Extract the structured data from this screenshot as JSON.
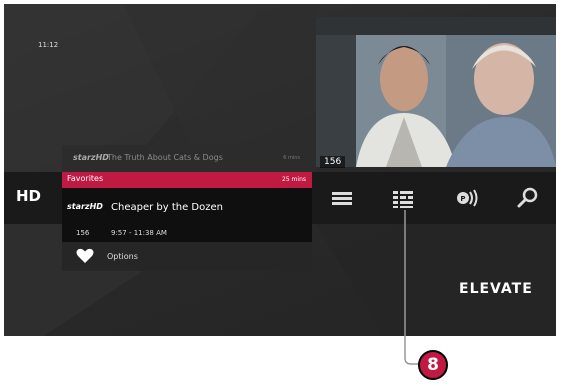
{
  "status": {
    "clock": "11:12"
  },
  "video": {
    "channel": "156"
  },
  "previous_program": {
    "network_logo": "starzHD",
    "title": "The Truth About Cats & Dogs",
    "remaining": "6 mins"
  },
  "navbar": {
    "hd_label": "HD",
    "icons": [
      "menu-icon",
      "guide-icon",
      "on-demand-icon",
      "search-icon"
    ]
  },
  "current_program": {
    "group_label": "Favorites",
    "remaining": "25 mins",
    "network_logo": "starzHD",
    "title": "Cheaper by the Dozen",
    "channel": "156",
    "time_range": "9:57 - 11:38 AM"
  },
  "options": {
    "label": "Options"
  },
  "brand": {
    "name": "ELEVATE"
  },
  "callout": {
    "number": "8"
  },
  "colors": {
    "accent": "#c11a42",
    "background": "#2b2b2b"
  }
}
